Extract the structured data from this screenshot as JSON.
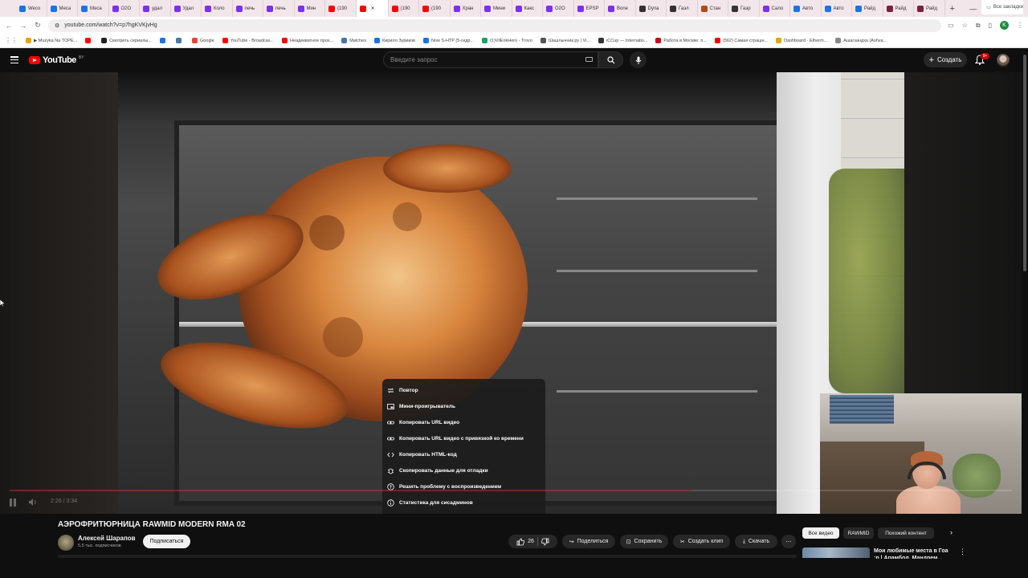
{
  "browser": {
    "tabs": [
      {
        "label": "Weco",
        "color": "#1a73e8"
      },
      {
        "label": "Меса",
        "color": "#1a73e8"
      },
      {
        "label": "Меса",
        "color": "#1a73e8"
      },
      {
        "label": "O2O",
        "color": "#7b2ff7"
      },
      {
        "label": "удал",
        "color": "#7b2ff7"
      },
      {
        "label": "Удал",
        "color": "#7b2ff7"
      },
      {
        "label": "Коло",
        "color": "#7b2ff7"
      },
      {
        "label": "печь",
        "color": "#7b2ff7"
      },
      {
        "label": "печь",
        "color": "#7b2ff7"
      },
      {
        "label": "Мин",
        "color": "#7b2ff7"
      },
      {
        "label": "(190",
        "color": "#ff0000"
      },
      {
        "label": "",
        "color": "#ff0000",
        "active": true
      },
      {
        "label": "(190",
        "color": "#ff0000"
      },
      {
        "label": "(190",
        "color": "#ff0000"
      },
      {
        "label": "Хран",
        "color": "#7b2ff7"
      },
      {
        "label": "Мини",
        "color": "#7b2ff7"
      },
      {
        "label": "Какс",
        "color": "#7b2ff7"
      },
      {
        "label": "O2O",
        "color": "#7b2ff7"
      },
      {
        "label": "EPSP",
        "color": "#7b2ff7"
      },
      {
        "label": "Bone",
        "color": "#7b2ff7"
      },
      {
        "label": "Dyna",
        "color": "#333"
      },
      {
        "label": "Гаэл",
        "color": "#333"
      },
      {
        "label": "Стан",
        "color": "#b04a1a"
      },
      {
        "label": "Гаэр",
        "color": "#333"
      },
      {
        "label": "Сало",
        "color": "#7b2ff7"
      },
      {
        "label": "Авто",
        "color": "#1a73e8"
      },
      {
        "label": "Авто",
        "color": "#1a73e8"
      },
      {
        "label": "Райд",
        "color": "#1a73e8"
      },
      {
        "label": "Райд",
        "color": "#7b1f3f"
      },
      {
        "label": "Райд",
        "color": "#7b1f3f"
      }
    ],
    "url": "youtube.com/watch?v=p7hgKVKjvHg",
    "profile_initial": "K",
    "bookmarks": [
      {
        "label": "▶ Muzyka Na TOPE...",
        "color": "#e5a400"
      },
      {
        "label": "",
        "color": "#ff0000"
      },
      {
        "label": "Смотреть сериалы...",
        "color": "#222"
      },
      {
        "label": "",
        "color": "#1a73e8"
      },
      {
        "label": "",
        "color": "#4a76a8"
      },
      {
        "label": "Google",
        "color": "#ea4335"
      },
      {
        "label": "YouTube - Broadcas...",
        "color": "#ff0000"
      },
      {
        "label": "Неадекватное прох...",
        "color": "#ff0000"
      },
      {
        "label": "Matches",
        "color": "#4a76a8"
      },
      {
        "label": "Кирилл Зуриков",
        "color": "#1a73e8"
      },
      {
        "label": "Now S-HTP (5-гидр...",
        "color": "#1a73e8"
      },
      {
        "label": "(1)VilEnkHero - Trovo",
        "color": "#1aa260"
      },
      {
        "label": "Шашлычник.ру | Vi...",
        "color": "#555"
      },
      {
        "label": "iCCup — Internatio...",
        "color": "#333"
      },
      {
        "label": "Работа в Москве: п...",
        "color": "#d0021b"
      },
      {
        "label": "(562) Самая страшн...",
        "color": "#ff0000"
      },
      {
        "label": "Dashboard - Etherm...",
        "color": "#e5a400"
      },
      {
        "label": "Ашагзандха (Ashva...",
        "color": "#888"
      }
    ],
    "all_bookmarks": "Все закладки"
  },
  "yt": {
    "logo_text": "YouTube",
    "logo_country": "BY",
    "search_placeholder": "Введите запрос",
    "create_label": "Создать",
    "notifications_badge": "9+"
  },
  "player": {
    "time": "2:26 / 3:34",
    "progress": 0.68,
    "context_menu": [
      {
        "label": "Повтор",
        "icon": "loop-icon"
      },
      {
        "label": "Мини-проигрыватель",
        "icon": "miniplayer-icon"
      },
      {
        "label": "Копировать URL видео",
        "icon": "link-icon"
      },
      {
        "label": "Копировать URL видео с привязкой ко времени",
        "icon": "link-icon"
      },
      {
        "label": "Копировать HTML-код",
        "icon": "code-icon"
      },
      {
        "label": "Скопировать данные для отладки",
        "icon": "debug-icon"
      },
      {
        "label": "Решить проблему с воспроизведением",
        "icon": "help-icon"
      },
      {
        "label": "Статистика для сисадминов",
        "icon": "info-icon"
      }
    ]
  },
  "video": {
    "title": "АЭРОФРИТЮРНИЦА RAWMID MODERN RMA 02",
    "channel_name": "Алексей Шарапов",
    "subscribers": "5,5 тыс. подписчиков",
    "subscribe_label": "Подписаться",
    "likes": "26",
    "share_label": "Поделиться",
    "save_label": "Сохранить",
    "clip_label": "Создать клип",
    "download_label": "Скачать"
  },
  "sidebar": {
    "chips": [
      "Все видео",
      "RAWMID",
      "Похожий контент"
    ],
    "rec_title": "Мои любимые места в Гоа :n | Арамбол, Мандрем..."
  }
}
